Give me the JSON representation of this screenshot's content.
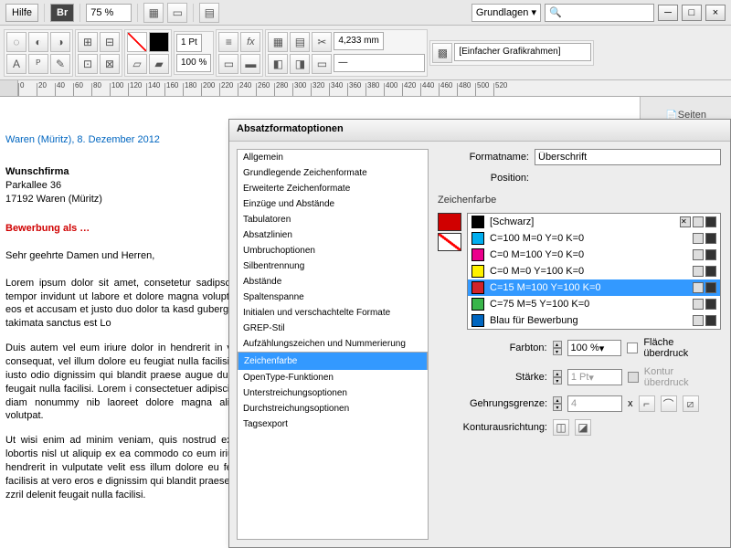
{
  "topbar": {
    "help": "Hilfe",
    "br": "Br",
    "zoom": "75 %",
    "workspace": "Grundlagen"
  },
  "toolrow": {
    "stroke": "1 Pt",
    "opacity": "100 %",
    "width_val": "4,233 mm",
    "frame_type": "[Einfacher Grafikrahmen]"
  },
  "ruler_ticks": [
    0,
    20,
    40,
    60,
    80,
    100,
    120,
    140,
    160,
    180,
    200,
    220,
    240,
    260,
    280,
    300,
    320,
    340,
    360,
    380,
    400,
    420,
    440,
    460,
    480,
    500,
    520
  ],
  "panel": {
    "pages": "Seiten"
  },
  "doc": {
    "date": "Waren (Müritz), 8. Dezember 2012",
    "firm": "Wunschfirma",
    "street": "Parkallee 36",
    "city": "17192 Waren (Müritz)",
    "subject": "Bewerbung als …",
    "greeting": "Sehr geehrte Damen und Herren,",
    "p1": "Lorem ipsum dolor sit amet, consetetur sadipscing eirmod tempor invidunt ut labore et dolore magna voluptua. At vero eos et accusam et justo duo dolor ta kasd gubergren, no sea takimata sanctus est Lo",
    "p2": "Duis autem vel eum iriure dolor in hendrerit in vu molestie consequat, vel illum dolore eu feugiat nulla facilisi cumsan et iusto odio dignissim qui blandit praese augue duis dolore te feugait nulla facilisi. Lorem i consectetuer adipiscing elit, sed diam nonummy nib laoreet dolore magna aliquam erat volutpat.",
    "p3": "Ut wisi enim ad minim veniam, quis nostrud exer suscipit lobortis nisl ut aliquip ex ea commodo co eum iriure dolor in hendrerit in vulputate velit ess illum dolore eu feugiat nulla facilisis at vero eros e dignissim qui blandit praesent luptatum zzril delenit feugait nulla facilisi."
  },
  "dialog": {
    "title": "Absatzformatoptionen",
    "categories": [
      "Allgemein",
      "Grundlegende Zeichenformate",
      "Erweiterte Zeichenformate",
      "Einzüge und Abstände",
      "Tabulatoren",
      "Absatzlinien",
      "Umbruchoptionen",
      "Silbentrennung",
      "Abstände",
      "Spaltenspanne",
      "Initialen und verschachtelte Formate",
      "GREP-Stil",
      "Aufzählungszeichen und Nummerierung",
      "Zeichenfarbe",
      "OpenType-Funktionen",
      "Unterstreichungsoptionen",
      "Durchstreichungsoptionen",
      "Tagsexport"
    ],
    "selected_category_index": 13,
    "formatname_label": "Formatname:",
    "formatname_value": "Überschrift",
    "position_label": "Position:",
    "section": "Zeichenfarbe",
    "swatches": [
      {
        "name": "[Schwarz]",
        "color": "#000000",
        "selected": false,
        "lock": true
      },
      {
        "name": "C=100 M=0 Y=0 K=0",
        "color": "#00aeef",
        "selected": false
      },
      {
        "name": "C=0 M=100 Y=0 K=0",
        "color": "#ec008c",
        "selected": false
      },
      {
        "name": "C=0 M=0 Y=100 K=0",
        "color": "#fff200",
        "selected": false
      },
      {
        "name": "C=15 M=100 Y=100 K=0",
        "color": "#d2232a",
        "selected": true
      },
      {
        "name": "C=75 M=5 Y=100 K=0",
        "color": "#39b54a",
        "selected": false
      },
      {
        "name": "Blau für Bewerbung",
        "color": "#0066c0",
        "selected": false
      }
    ],
    "tint_label": "Farbton:",
    "tint_value": "100 %",
    "overprint_fill": "Fläche überdruck",
    "stroke_label": "Stärke:",
    "stroke_value": "1 Pt",
    "overprint_stroke": "Kontur überdruck",
    "miter_label": "Gehrungsgrenze:",
    "miter_value": "4",
    "miter_x": "x",
    "align_label": "Konturausrichtung:"
  }
}
